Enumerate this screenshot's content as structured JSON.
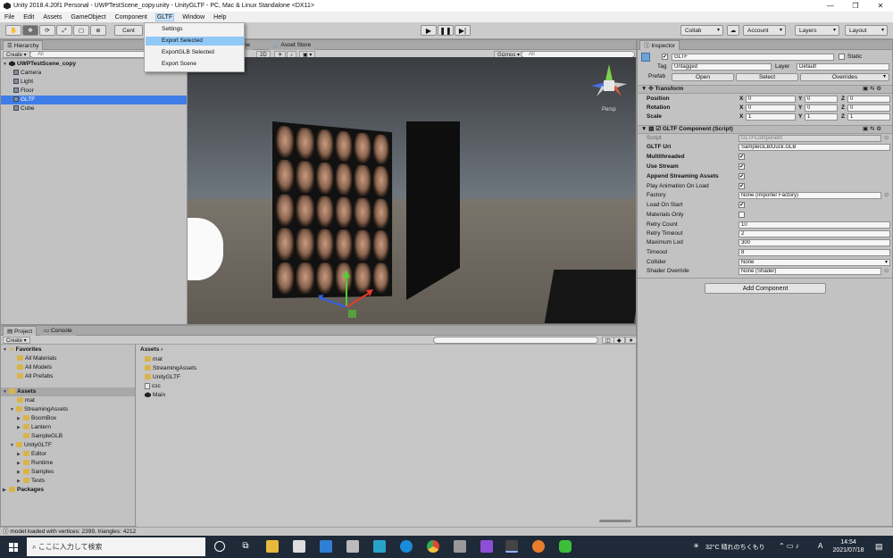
{
  "window": {
    "title": "Unity 2018.4.20f1 Personal - UWPTestScene_copy.unity - UnityGLTF - PC, Mac & Linux Standalone <DX11>"
  },
  "menubar": {
    "items": [
      "File",
      "Edit",
      "Assets",
      "GameObject",
      "Component",
      "GLTF",
      "Window",
      "Help"
    ]
  },
  "gltf_menu": {
    "items": [
      "Settings",
      "Export Selected",
      "ExportGLB Selected",
      "Export Scene"
    ]
  },
  "toolbar": {
    "center_label": "Cent",
    "collab": "Collab",
    "account": "Account",
    "layers": "Layers",
    "layout": "Layout"
  },
  "hierarchy": {
    "tab": "Hierarchy",
    "create": "Create",
    "search_placeholder": "All",
    "scene": "UWPTestScene_copy",
    "items": [
      "Camera",
      "Light",
      "Floor",
      "GLTF",
      "Cube"
    ]
  },
  "scene": {
    "tabs": [
      "me",
      "Asset Store"
    ],
    "mode_2d": "2D",
    "gizmos": "Gizmos",
    "search_placeholder": "All",
    "persp": "Persp"
  },
  "project": {
    "tabs": [
      "Project",
      "Console"
    ],
    "create": "Create",
    "favorites_label": "Favorites",
    "favorites": [
      "All Materials",
      "All Models",
      "All Prefabs"
    ],
    "assets_label": "Assets",
    "tree": [
      "mat",
      "StreamingAssets",
      "BoomBox",
      "Lantern",
      "SampleGLB",
      "UnityGLTF",
      "Editor",
      "Runtime",
      "Samples",
      "Tests"
    ],
    "packages_label": "Packages",
    "breadcrumb": "Assets",
    "files": [
      "mat",
      "StreamingAssets",
      "UnityGLTF",
      "csc",
      "Main"
    ]
  },
  "status": {
    "text": "model loaded with vertices: 2399, triangles: 4212"
  },
  "inspector": {
    "tab": "Inspector",
    "object_name": "GLTF",
    "static_label": "Static",
    "tag_label": "Tag",
    "tag": "Untagged",
    "layer_label": "Layer",
    "layer": "Default",
    "prefab_label": "Prefab",
    "open": "Open",
    "select": "Select",
    "overrides": "Overrides",
    "transform": {
      "title": "Transform",
      "rows": [
        {
          "label": "Position",
          "x": "0",
          "y": "0",
          "z": "0"
        },
        {
          "label": "Rotation",
          "x": "0",
          "y": "0",
          "z": "0"
        },
        {
          "label": "Scale",
          "x": "1",
          "y": "1",
          "z": "1"
        }
      ]
    },
    "component": {
      "title": "GLTF Component (Script)",
      "script_label": "Script",
      "script": "GLTFComponent",
      "uri_label": "GLTF Uri",
      "uri": "SampleGLB/Duck.GLB",
      "multithreaded": "Multithreaded",
      "use_stream": "Use Stream",
      "append_streaming": "Append Streaming Assets",
      "play_anim": "Play Animation On Load",
      "factory_label": "Factory",
      "factory": "None (Importer Factory)",
      "load_on_start": "Load On Start",
      "materials_only": "Materials Only",
      "retry_count_label": "Retry Count",
      "retry_count": "10",
      "retry_timeout_label": "Retry Timeout",
      "retry_timeout": "2",
      "max_lod_label": "Maximum Lod",
      "max_lod": "300",
      "timeout_label": "Timeout",
      "timeout": "8",
      "collider_label": "Collider",
      "collider": "None",
      "shader_label": "Shader Override",
      "shader": "None (Shader)"
    },
    "add_component": "Add Component"
  },
  "taskbar": {
    "search_placeholder": "ここに入力して検索",
    "weather": "32°C 晴れのちくもり",
    "ime": "A",
    "time": "14:54",
    "date": "2021/07/18"
  }
}
